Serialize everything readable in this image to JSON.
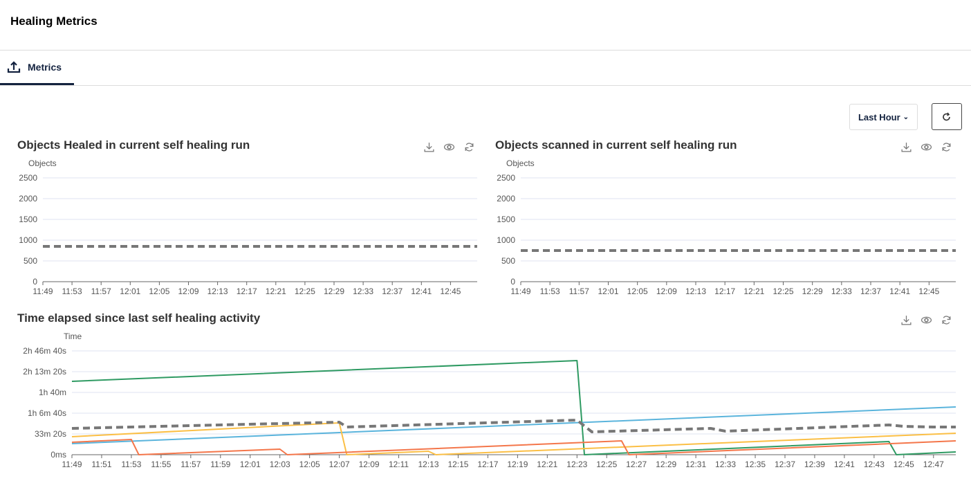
{
  "header": {
    "title": "Healing Metrics"
  },
  "tabs": [
    {
      "label": "Metrics",
      "icon": "upload-icon",
      "active": true
    }
  ],
  "toolbar": {
    "range_label": "Last Hour",
    "refresh_icon": "refresh-icon"
  },
  "chart_actions": [
    "download-icon",
    "eye-icon",
    "refresh-icon"
  ],
  "chart_data": [
    {
      "type": "line",
      "title": "Objects Healed in current self healing run",
      "ylabel": "Objects",
      "ylim": [
        0,
        2500
      ],
      "yticks": [
        {
          "v": 0,
          "label": "0"
        },
        {
          "v": 500,
          "label": "500"
        },
        {
          "v": 1000,
          "label": "1000"
        },
        {
          "v": 1500,
          "label": "1500"
        },
        {
          "v": 2000,
          "label": "2000"
        },
        {
          "v": 2500,
          "label": "2500"
        }
      ],
      "xlim": [
        "11:49",
        "12:48:40"
      ],
      "xticks": [
        "11:49",
        "11:53",
        "11:57",
        "12:01",
        "12:05",
        "12:09",
        "12:13",
        "12:17",
        "12:21",
        "12:25",
        "12:29",
        "12:33",
        "12:37",
        "12:41",
        "12:45"
      ],
      "series": [
        {
          "color": "#777777",
          "dashed": true,
          "points": [
            [
              "11:49",
              850
            ],
            [
              "12:48:40",
              850
            ]
          ]
        }
      ]
    },
    {
      "type": "line",
      "title": "Objects scanned in current self healing run",
      "ylabel": "Objects",
      "ylim": [
        0,
        2500
      ],
      "yticks": [
        {
          "v": 0,
          "label": "0"
        },
        {
          "v": 500,
          "label": "500"
        },
        {
          "v": 1000,
          "label": "1000"
        },
        {
          "v": 1500,
          "label": "1500"
        },
        {
          "v": 2000,
          "label": "2000"
        },
        {
          "v": 2500,
          "label": "2500"
        }
      ],
      "xlim": [
        "11:49",
        "12:48:40"
      ],
      "xticks": [
        "11:49",
        "11:53",
        "11:57",
        "12:01",
        "12:05",
        "12:09",
        "12:13",
        "12:17",
        "12:21",
        "12:25",
        "12:29",
        "12:33",
        "12:37",
        "12:41",
        "12:45"
      ],
      "series": [
        {
          "color": "#777777",
          "dashed": true,
          "points": [
            [
              "11:49",
              750
            ],
            [
              "12:48:40",
              750
            ]
          ]
        }
      ]
    },
    {
      "type": "line",
      "title": "Time elapsed since last self healing activity",
      "ylabel": "Time",
      "ylim": [
        0,
        10000
      ],
      "yticks": [
        {
          "v": 0,
          "label": "0ms"
        },
        {
          "v": 2000,
          "label": "33m 20s"
        },
        {
          "v": 4000,
          "label": "1h 6m 40s"
        },
        {
          "v": 6000,
          "label": "1h 40m"
        },
        {
          "v": 8000,
          "label": "2h 13m 20s"
        },
        {
          "v": 10000,
          "label": "2h 46m 40s"
        }
      ],
      "xlim": [
        "11:49",
        "12:48:30"
      ],
      "xticks": [
        "11:49",
        "11:51",
        "11:53",
        "11:55",
        "11:57",
        "11:59",
        "12:01",
        "12:03",
        "12:05",
        "12:07",
        "12:09",
        "12:11",
        "12:13",
        "12:15",
        "12:17",
        "12:19",
        "12:21",
        "12:23",
        "12:25",
        "12:27",
        "12:29",
        "12:31",
        "12:33",
        "12:35",
        "12:37",
        "12:39",
        "12:41",
        "12:43",
        "12:45",
        "12:47"
      ],
      "series": [
        {
          "color": "#2e9a62",
          "dashed": false,
          "points": [
            [
              "11:49",
              7067
            ],
            [
              "12:23",
              9067
            ],
            [
              "12:23:30",
              0
            ],
            [
              "12:44",
              1267
            ],
            [
              "12:44:30",
              0
            ],
            [
              "12:48:30",
              267
            ]
          ]
        },
        {
          "color": "#5ab4dc",
          "dashed": false,
          "points": [
            [
              "11:49",
              1067
            ],
            [
              "12:48:30",
              4600
            ]
          ]
        },
        {
          "color": "#fbbf45",
          "dashed": false,
          "points": [
            [
              "11:49",
              1733
            ],
            [
              "12:07",
              3067
            ],
            [
              "12:07:30",
              0
            ],
            [
              "12:13",
              333
            ],
            [
              "12:13:30",
              0
            ],
            [
              "12:48:30",
              2067
            ]
          ]
        },
        {
          "color": "#f4764a",
          "dashed": false,
          "points": [
            [
              "11:49",
              1200
            ],
            [
              "11:53",
              1467
            ],
            [
              "11:53:30",
              0
            ],
            [
              "12:03",
              533
            ],
            [
              "12:03:30",
              0
            ],
            [
              "12:26",
              1333
            ],
            [
              "12:26:30",
              0
            ],
            [
              "12:48:30",
              1333
            ]
          ]
        },
        {
          "color": "#777777",
          "dashed": true,
          "points": [
            [
              "11:49",
              2533
            ],
            [
              "12:07",
              3133
            ],
            [
              "12:07:30",
              2667
            ],
            [
              "12:23",
              3333
            ],
            [
              "12:24",
              2200
            ],
            [
              "12:32",
              2533
            ],
            [
              "12:33",
              2267
            ],
            [
              "12:44",
              2867
            ],
            [
              "12:45",
              2733
            ],
            [
              "12:47",
              2667
            ],
            [
              "12:48:30",
              2667
            ]
          ]
        }
      ]
    }
  ]
}
